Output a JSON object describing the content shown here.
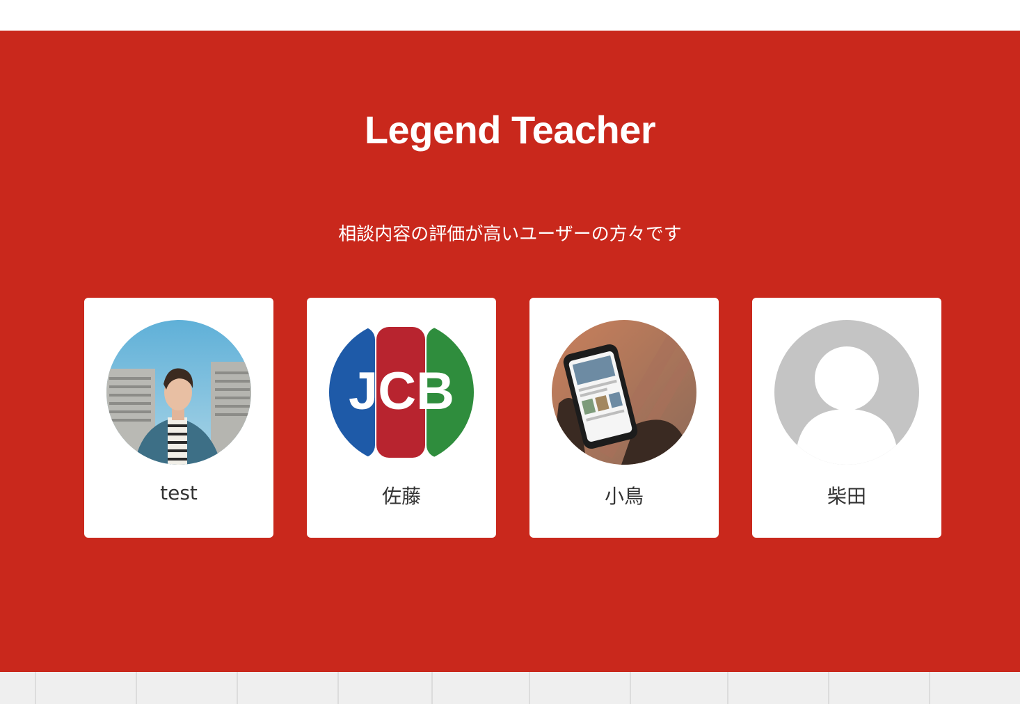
{
  "section": {
    "title": "Legend Teacher",
    "subtitle": "相談内容の評価が高いユーザーの方々です",
    "background_color": "#c9281c"
  },
  "teachers": [
    {
      "name": "test",
      "avatar": "photo-man-profile"
    },
    {
      "name": "佐藤",
      "avatar": "jcb-logo"
    },
    {
      "name": "小鳥",
      "avatar": "photo-smartphone-hands"
    },
    {
      "name": "柴田",
      "avatar": "default-user-icon"
    }
  ]
}
